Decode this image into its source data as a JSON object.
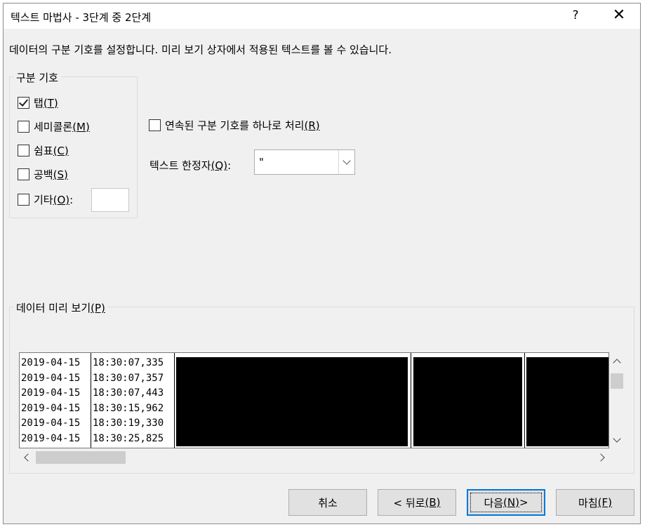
{
  "window": {
    "title": "텍스트 마법사 - 3단계 중 2단계",
    "help_label": "?",
    "close_label": "✕"
  },
  "description": "데이터의 구분 기호를 설정합니다. 미리 보기 상자에서 적용된 텍스트를 볼 수 있습니다.",
  "delimiters": {
    "legend": "구분 기호",
    "items": [
      {
        "text": "탭",
        "mnemonic": "(T)",
        "checked": true
      },
      {
        "text": "세미콜론",
        "mnemonic": "(M)",
        "checked": false
      },
      {
        "text": "쉼표",
        "mnemonic": "(C)",
        "checked": false
      },
      {
        "text": "공백",
        "mnemonic": "(S)",
        "checked": false
      },
      {
        "text": "기타",
        "mnemonic": "(O)",
        "suffix": ":",
        "checked": false
      }
    ],
    "other_value": ""
  },
  "consecutive": {
    "text": "연속된 구분 기호를 하나로 처리",
    "mnemonic": "(R)",
    "checked": false
  },
  "qualifier": {
    "label": "텍스트 한정자",
    "mnemonic": "(Q)",
    "suffix": ":",
    "value": "\""
  },
  "preview": {
    "legend": "데이터 미리 보기",
    "mnemonic": "(P)",
    "col_dates": [
      "2019-04-15",
      "2019-04-15",
      "2019-04-15",
      "2019-04-15",
      "2019-04-15",
      "2019-04-15"
    ],
    "col_times": [
      "18:30:07,335",
      "18:30:07,357",
      "18:30:07,443",
      "18:30:15,962",
      "18:30:19,330",
      "18:30:25,825"
    ]
  },
  "buttons": {
    "cancel": "취소",
    "back_text": "< 뒤로",
    "back_mn": "(B)",
    "next_text": "다음",
    "next_mn": "(N)",
    "next_suffix": " >",
    "finish_text": "마침",
    "finish_mn": "(F)"
  }
}
